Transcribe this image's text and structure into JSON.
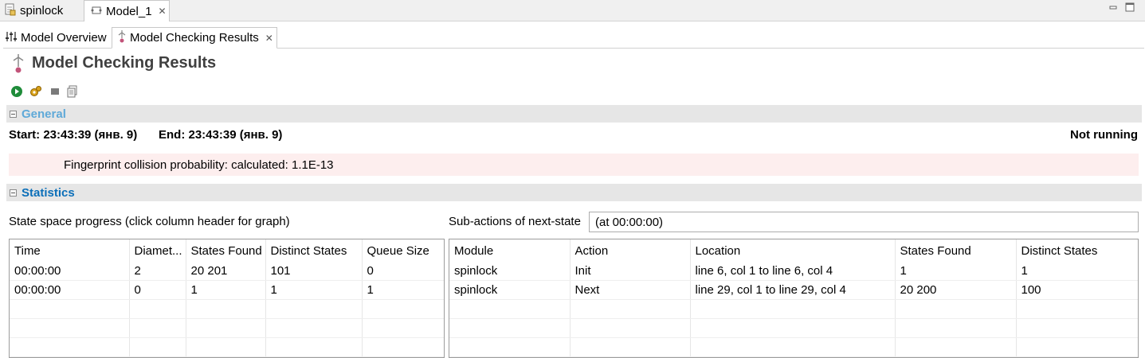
{
  "editor_tabs": [
    {
      "label": "spinlock"
    },
    {
      "label": "Model_1"
    }
  ],
  "page_tabs": [
    {
      "label": "Model Overview"
    },
    {
      "label": "Model Checking Results"
    }
  ],
  "page_title": "Model Checking Results",
  "toolbar": [
    "run-icon",
    "run-with-options-icon",
    "stop-icon",
    "copy-icon"
  ],
  "general": {
    "title": "General",
    "start": "Start: 23:43:39 (янв. 9)",
    "end": "End: 23:43:39 (янв. 9)",
    "status": "Not running",
    "fingerprint": "Fingerprint collision probability: calculated: 1.1E-13"
  },
  "statistics": {
    "title": "Statistics",
    "state_space_label": "State space progress (click column header for graph)",
    "subactions_label": "Sub-actions of next-state",
    "subactions_value": "(at 00:00:00)",
    "state_table": {
      "headers": [
        "Time",
        "Diamet...",
        "States Found",
        "Distinct States",
        "Queue Size"
      ],
      "rows": [
        [
          "00:00:00",
          "2",
          "20 201",
          "101",
          "0"
        ],
        [
          "00:00:00",
          "0",
          "1",
          "1",
          "1"
        ]
      ]
    },
    "action_table": {
      "headers": [
        "Module",
        "Action",
        "Location",
        "States Found",
        "Distinct States"
      ],
      "rows": [
        [
          "spinlock",
          "Init",
          "line 6, col 1 to line 6, col 4",
          "1",
          "1"
        ],
        [
          "spinlock",
          "Next",
          "line 29, col 1 to line 29, col 4",
          "20 200",
          "100"
        ]
      ]
    }
  },
  "colors": {
    "section_title": "#0b6fb9",
    "fingerprint_bg": "#fdeeee"
  }
}
